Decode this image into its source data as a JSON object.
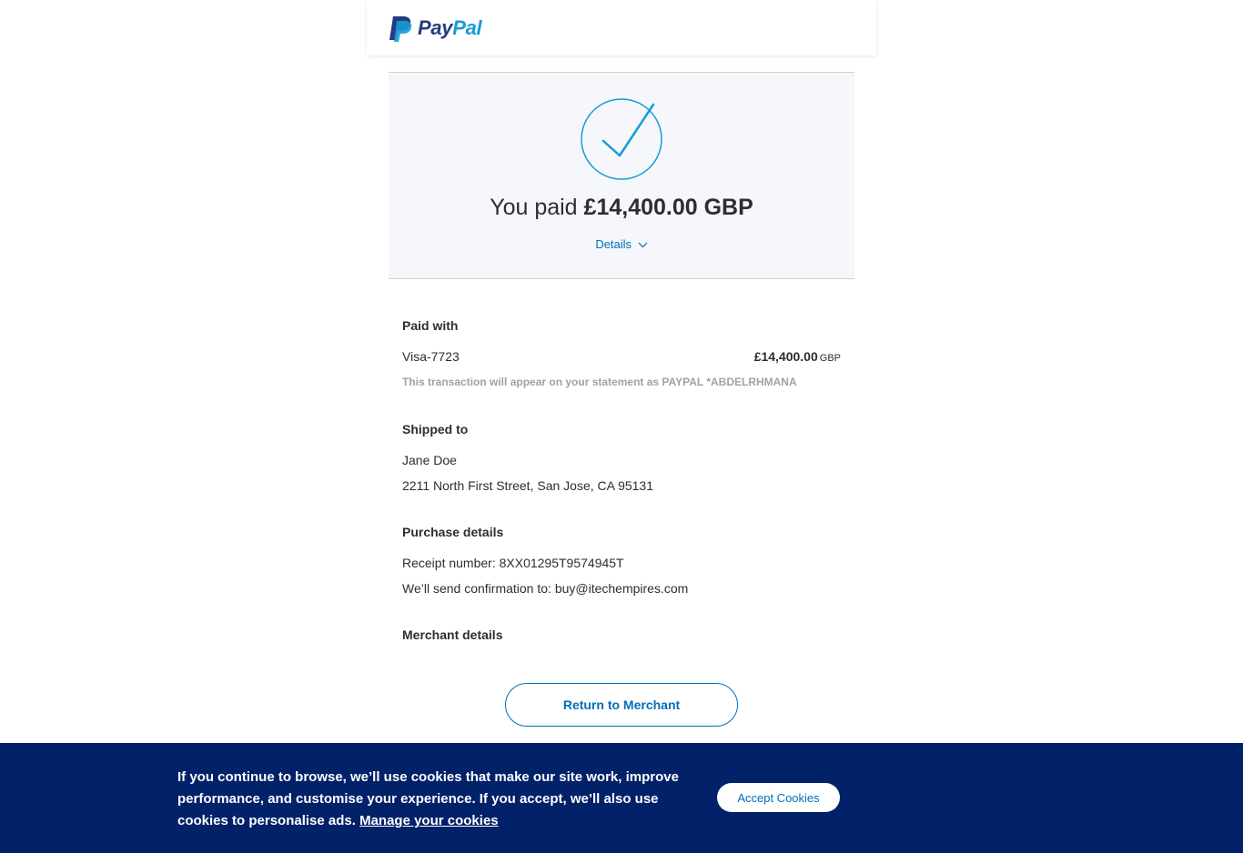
{
  "header": {
    "logo_pay": "Pay",
    "logo_pal": "Pal"
  },
  "hero": {
    "paid_prefix": "You paid ",
    "paid_amount": "£14,400.00 GBP",
    "details_label": "Details"
  },
  "paid_with": {
    "title": "Paid with",
    "card": "Visa-7723",
    "amount": "£14,400.00",
    "currency": "GBP",
    "statement_note": "This transaction will appear on your statement as PAYPAL *ABDELRHMANA"
  },
  "shipped_to": {
    "title": "Shipped to",
    "name": "Jane Doe",
    "address": "2211 North First Street, San Jose, CA 95131"
  },
  "purchase_details": {
    "title": "Purchase details",
    "receipt": "Receipt number: 8XX01295T9574945T",
    "confirmation": "We’ll send confirmation to: buy@itechempires.com"
  },
  "merchant_details": {
    "title": "Merchant details"
  },
  "return_button": "Return to Merchant",
  "cookie_banner": {
    "text": "If you continue to browse, we’ll use cookies that make our site work, improve performance, and customise your experience. If you accept, we’ll also use cookies to personalise ads. ",
    "manage_link": "Manage your cookies",
    "accept_button": "Accept Cookies"
  },
  "colors": {
    "brand_dark": "#253b80",
    "brand_light": "#179bd7",
    "link_blue": "#0070ba",
    "cookie_bg": "#012169",
    "hero_bg": "#f5f7fa"
  }
}
